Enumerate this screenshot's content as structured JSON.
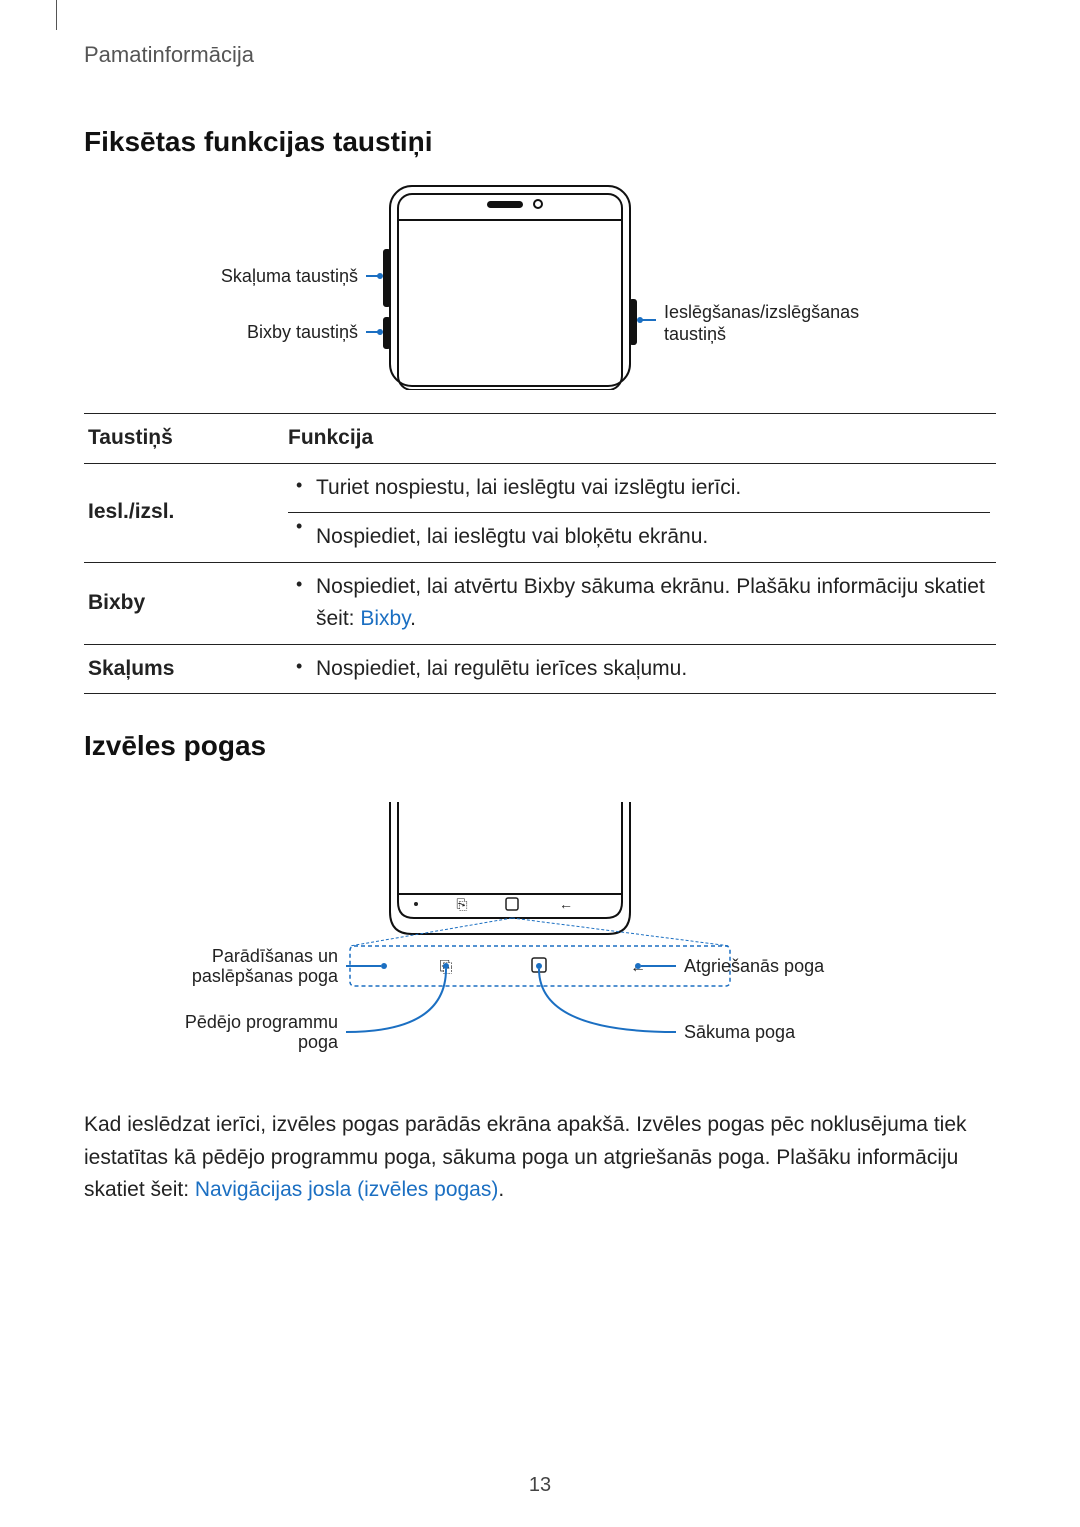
{
  "header": "Pamatinformācija",
  "h1": "Fiksētas funkcijas taustiņi",
  "diagram1": {
    "volume": "Skaļuma taustiņš",
    "bixby": "Bixby taustiņš",
    "power": "Ieslēgšanas/izslēgšanas taustiņš"
  },
  "table": {
    "head_key": "Taustiņš",
    "head_func": "Funkcija",
    "rows": [
      {
        "key": "Iesl./izsl.",
        "items": [
          "Turiet nospiestu, lai ieslēgtu vai izslēgtu ierīci.",
          "Nospiediet, lai ieslēgtu vai bloķētu ekrānu."
        ]
      },
      {
        "key": "Bixby",
        "items_prefix": "Nospiediet, lai atvērtu Bixby sākuma ekrānu. Plašāku informāciju skatiet šeit: ",
        "link": "Bixby",
        "items_suffix": "."
      },
      {
        "key": "Skaļums",
        "items": [
          "Nospiediet, lai regulētu ierīces skaļumu."
        ]
      }
    ]
  },
  "h2": "Izvēles pogas",
  "diagram2": {
    "showhide": "Parādīšanas un paslēpšanas poga",
    "recents": "Pēdējo programmu poga",
    "back": "Atgriešanās poga",
    "home": "Sākuma poga"
  },
  "para_prefix": "Kad ieslēdzat ierīci, izvēles pogas parādās ekrāna apakšā. Izvēles pogas pēc noklusējuma tiek iestatītas kā pēdējo programmu poga, sākuma poga un atgriešanās poga. Plašāku informāciju skatiet šeit: ",
  "para_link": "Navigācijas josla (izvēles pogas)",
  "para_suffix": ".",
  "pagenum": "13"
}
